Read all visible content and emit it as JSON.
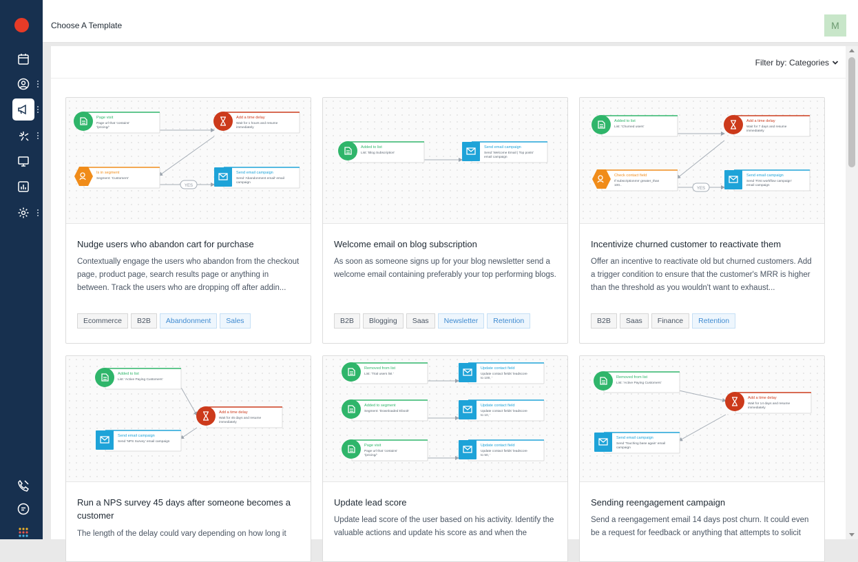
{
  "header": {
    "title": "Choose A Template",
    "avatar_initial": "M"
  },
  "filter": {
    "label": "Filter by: Categories"
  },
  "sidebar": {
    "items": [
      {
        "name": "calendar-icon"
      },
      {
        "name": "user-circle-icon"
      },
      {
        "name": "megaphone-icon",
        "active": true
      },
      {
        "name": "sparkle-icon"
      },
      {
        "name": "monitor-icon"
      },
      {
        "name": "chart-icon"
      },
      {
        "name": "gear-icon"
      }
    ],
    "bottom": [
      {
        "name": "phone-icon"
      },
      {
        "name": "chat-icon"
      },
      {
        "name": "apps-grid-icon"
      }
    ]
  },
  "colors": {
    "green": "#2fb56a",
    "orange": "#f08c1a",
    "red": "#cc3a1b",
    "blue": "#1ea3d8"
  },
  "cards": [
    {
      "title": "Nudge users who abandon cart for purchase",
      "description": "Contextually engage the users who abandon from the checkout page, product page, search results page or anything in between. Track the users who are dropping off after addin...",
      "tags": [
        {
          "label": "Ecommerce",
          "style": "gray"
        },
        {
          "label": "B2B",
          "style": "gray"
        },
        {
          "label": "Abandonment",
          "style": "blue"
        },
        {
          "label": "Sales",
          "style": "blue"
        }
      ],
      "nodes": [
        {
          "t": "Page visit",
          "s": "Page url that 'contains' '/pricing/'",
          "c": "green"
        },
        {
          "t": "Add a time delay",
          "s": "Wait for 1 hours and resume immediately",
          "c": "red"
        },
        {
          "t": "Is in segment",
          "s": "Segment: 'Customers'",
          "c": "orange"
        },
        {
          "t": "Send email campaign",
          "s": "Send 'Abandonment email' email campaign",
          "c": "blue"
        }
      ],
      "pill": "YES"
    },
    {
      "title": "Welcome email on blog subscription",
      "description": "As soon as someone signs up for your blog newsletter send a welcome email containing preferably your top performing blogs.",
      "tags": [
        {
          "label": "B2B",
          "style": "gray"
        },
        {
          "label": "Blogging",
          "style": "gray"
        },
        {
          "label": "Saas",
          "style": "gray"
        },
        {
          "label": "Newsletter",
          "style": "blue"
        },
        {
          "label": "Retention",
          "style": "blue"
        }
      ],
      "nodes": [
        {
          "t": "Added to list",
          "s": "List: 'Blog Subscription'",
          "c": "green"
        },
        {
          "t": "Send email campaign",
          "s": "Send 'Welcome Email | Top posts' email campaign",
          "c": "blue"
        }
      ]
    },
    {
      "title": "Incentivize churned customer to reactivate them",
      "description": "Offer an incentive to reactivate old but churned customers. Add a trigger condition to ensure that the customer's MRR is higher than the threshold as you wouldn't want to exhaust...",
      "tags": [
        {
          "label": "B2B",
          "style": "gray"
        },
        {
          "label": "Saas",
          "style": "gray"
        },
        {
          "label": "Finance",
          "style": "gray"
        },
        {
          "label": "Retention",
          "style": "blue"
        }
      ],
      "nodes": [
        {
          "t": "Added to list",
          "s": "List: 'Churned users'",
          "c": "green"
        },
        {
          "t": "Add a time delay",
          "s": "Wait for 7 days and resume immediately",
          "c": "red"
        },
        {
          "t": "Check contact field",
          "s": "If subscriptionmrr greater_than 100..",
          "c": "orange"
        },
        {
          "t": "Send email campaign",
          "s": "Send 'First workflow campaign' email campaign",
          "c": "blue"
        }
      ],
      "pill": "YES"
    },
    {
      "title": "Run a NPS survey 45 days after someone becomes a customer",
      "description": "The length of the delay could vary depending on how long it",
      "tags": [],
      "nodes": [
        {
          "t": "Added to list",
          "s": "List: 'Active Paying Customers'",
          "c": "green"
        },
        {
          "t": "Add a time delay",
          "s": "Wait for 45 days and resume immediately",
          "c": "red"
        },
        {
          "t": "Send email campaign",
          "s": "Send 'NPS Survey' email campaign",
          "c": "blue"
        }
      ]
    },
    {
      "title": "Update lead score",
      "description": "Update lead score of the user based on his activity. Identify the valuable actions and update his score as and when the",
      "tags": [],
      "nodes": [
        {
          "t": "Removed from list",
          "s": "List: 'Trial users list '",
          "c": "green"
        },
        {
          "t": "Update contact field",
          "s": "Update contact fields' leadscore to 100, '",
          "c": "blue"
        },
        {
          "t": "Added to segment",
          "s": "Segment: 'Downloaded Ebook'",
          "c": "green"
        },
        {
          "t": "Update contact field",
          "s": "Update contact fields' leadscore to 10, '",
          "c": "blue"
        },
        {
          "t": "Page visit",
          "s": "Page url that 'contains' '/pricing/'",
          "c": "green"
        },
        {
          "t": "Update contact field",
          "s": "Update contact fields' leadscore to 50, '",
          "c": "blue"
        }
      ]
    },
    {
      "title": "Sending reengagement campaign",
      "description": "Send a reengagement email 14 days post churn. It could even be a request for feedback or anything that attempts to solicit",
      "tags": [],
      "nodes": [
        {
          "t": "Removed from list",
          "s": "List: 'Active Paying Customers'",
          "c": "green"
        },
        {
          "t": "Add a time delay",
          "s": "Wait for 14 days and resume immediately",
          "c": "red"
        },
        {
          "t": "Send email campaign",
          "s": "Send 'Touching base again' email campaign",
          "c": "blue"
        }
      ]
    }
  ]
}
